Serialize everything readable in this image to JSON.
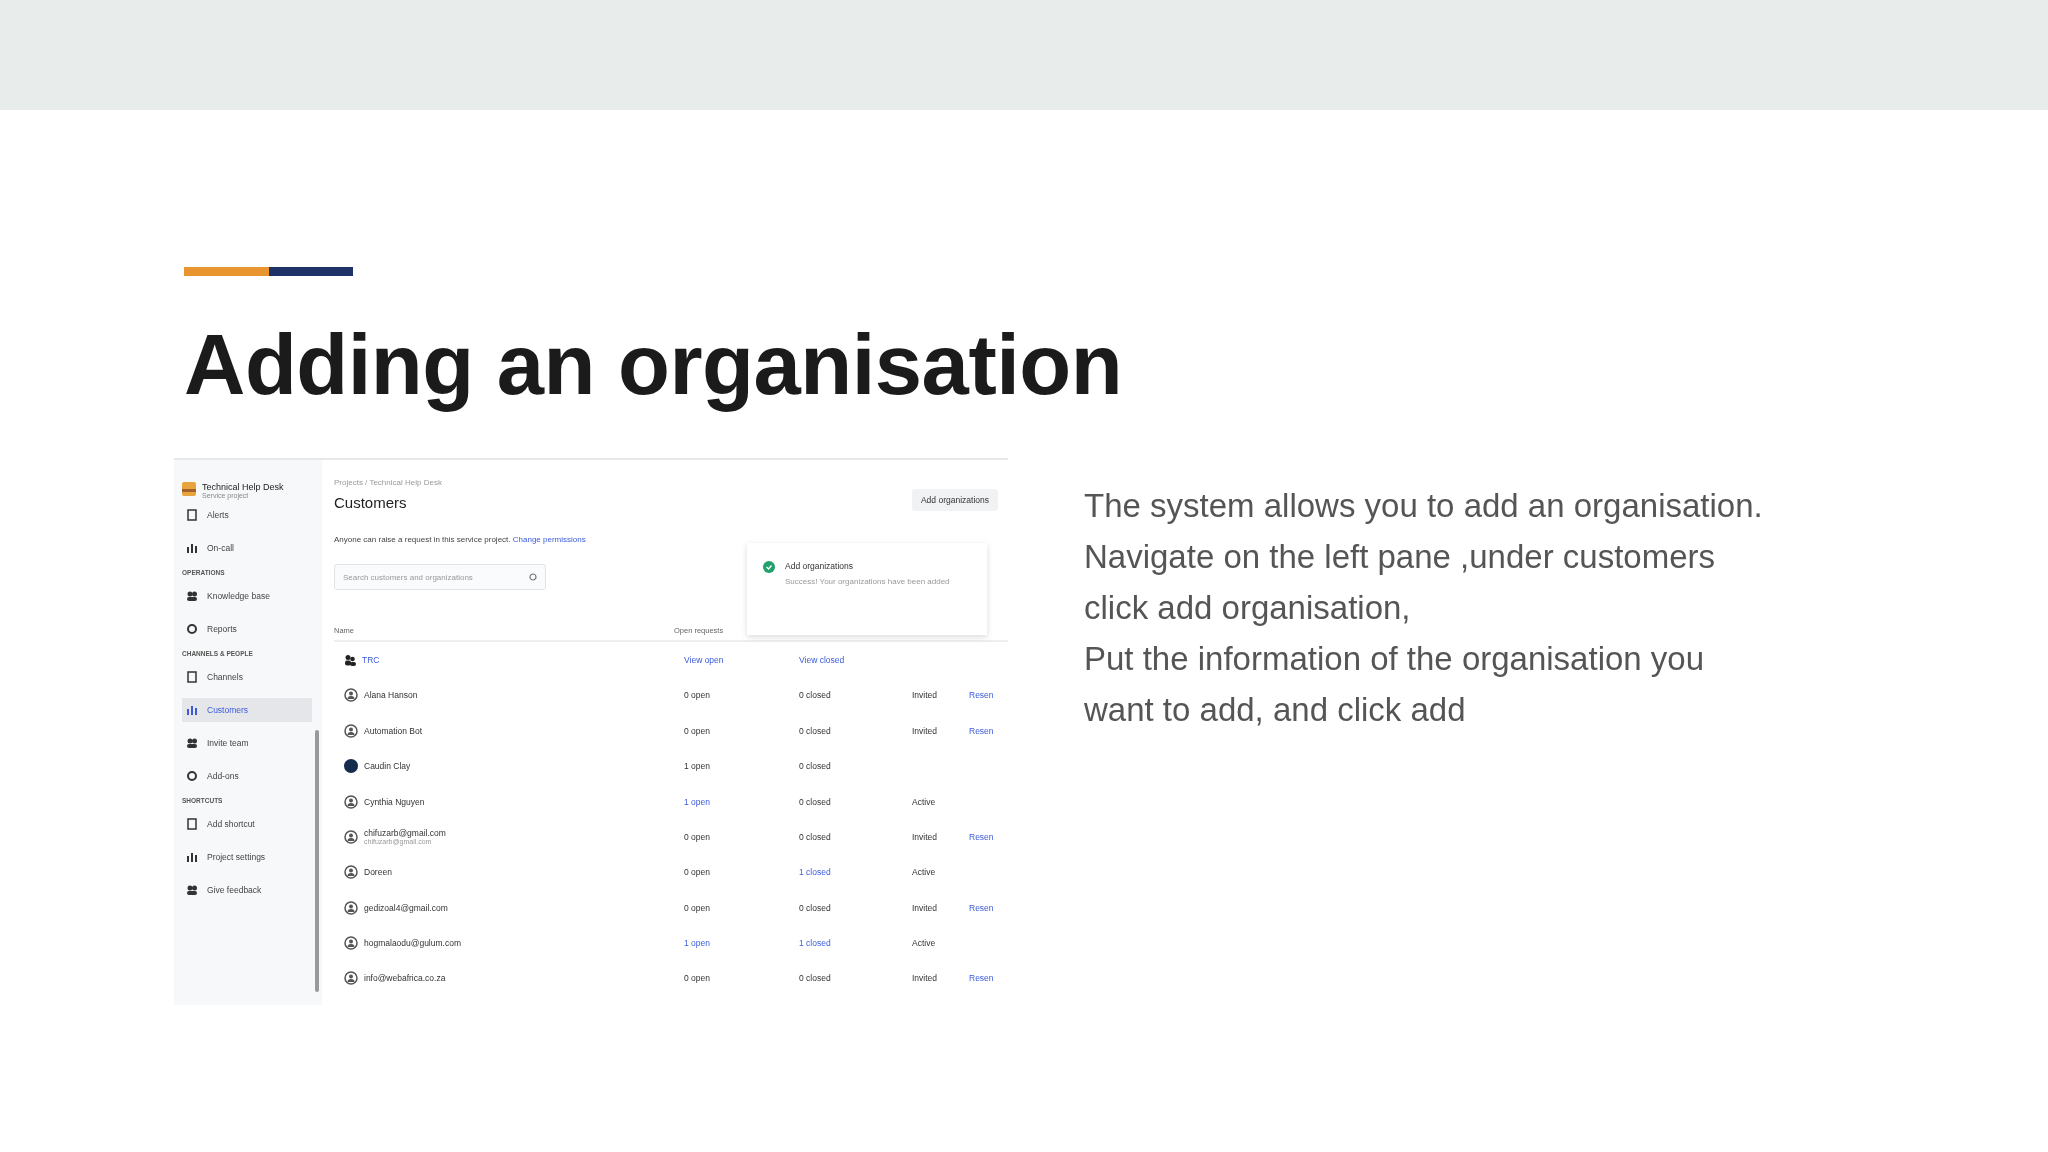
{
  "slide": {
    "title": "Adding an organisation",
    "description": "The system allows you to add an organisation.\nNavigate on the left pane ,under customers\nclick add organisation,\nPut the information of the organisation you\nwant to add, and click add"
  },
  "app": {
    "project": {
      "name": "Technical Help Desk",
      "type": "Service project"
    },
    "sidebar": [
      {
        "kind": "item",
        "label": "Alerts",
        "selected": false
      },
      {
        "kind": "item",
        "label": "On-call",
        "selected": false
      },
      {
        "kind": "section",
        "label": "OPERATIONS"
      },
      {
        "kind": "item",
        "label": "Knowledge base",
        "selected": false
      },
      {
        "kind": "item",
        "label": "Reports",
        "selected": false
      },
      {
        "kind": "section",
        "label": "CHANNELS & PEOPLE"
      },
      {
        "kind": "item",
        "label": "Channels",
        "selected": false
      },
      {
        "kind": "item",
        "label": "Customers",
        "selected": true
      },
      {
        "kind": "item",
        "label": "Invite team",
        "selected": false
      },
      {
        "kind": "item",
        "label": "Add-ons",
        "selected": false
      },
      {
        "kind": "section",
        "label": "SHORTCUTS"
      },
      {
        "kind": "item",
        "label": "Add shortcut",
        "selected": false
      },
      {
        "kind": "item",
        "label": "Project settings",
        "selected": false
      },
      {
        "kind": "item",
        "label": "Give feedback",
        "selected": false
      }
    ],
    "breadcrumb": [
      "Projects",
      "/",
      "Technical Help Desk"
    ],
    "heading": "Customers",
    "add_button": "Add organizations",
    "notice": "Anyone can raise a request in this service project.",
    "notice_link": "Change permissions",
    "search": {
      "placeholder": "Search customers and organizations"
    },
    "toast": {
      "title": "Add organizations",
      "message": "Success! Your organizations have been added"
    },
    "table": {
      "columns": [
        "Name",
        "Open requests"
      ],
      "organization": {
        "name": "TRC",
        "open": "View open",
        "closed": "View closed"
      },
      "rows": [
        {
          "name": "Alana Hanson",
          "dark_avatar": false,
          "open": "0 open",
          "open_link": false,
          "closed": "0 closed",
          "closed_link": false,
          "status": "Invited",
          "action": "Resen"
        },
        {
          "name": "Automation Bot",
          "dark_avatar": false,
          "open": "0 open",
          "open_link": false,
          "closed": "0 closed",
          "closed_link": false,
          "status": "Invited",
          "action": "Resen"
        },
        {
          "name": "Caudin Clay",
          "dark_avatar": true,
          "open": "1 open",
          "open_link": false,
          "closed": "0 closed",
          "closed_link": false
        },
        {
          "name": "Cynthia Nguyen",
          "dark_avatar": false,
          "open": "1 open",
          "open_link": true,
          "closed": "0 closed",
          "closed_link": false,
          "status": "Active"
        },
        {
          "name": "chifuzarb@gmail.com",
          "sub": "chifuzarb@gmail.com",
          "dark_avatar": false,
          "open": "0 open",
          "open_link": false,
          "closed": "0 closed",
          "closed_link": false,
          "status": "Invited",
          "action": "Resen"
        },
        {
          "name": "Doreen",
          "dark_avatar": false,
          "open": "0 open",
          "open_link": false,
          "closed": "1 closed",
          "closed_link": true,
          "status": "Active"
        },
        {
          "name": "gedizoal4@gmail.com",
          "dark_avatar": false,
          "open": "0 open",
          "open_link": false,
          "closed": "0 closed",
          "closed_link": false,
          "status": "Invited",
          "action": "Resen"
        },
        {
          "name": "hogmalaodu@gulum.com",
          "dark_avatar": false,
          "open": "1 open",
          "open_link": true,
          "closed": "1 closed",
          "closed_link": true,
          "status": "Active"
        },
        {
          "name": "info@webafrica.co.za",
          "dark_avatar": false,
          "open": "0 open",
          "open_link": false,
          "closed": "0 closed",
          "closed_link": false,
          "status": "Invited",
          "action": "Resen"
        }
      ]
    }
  }
}
